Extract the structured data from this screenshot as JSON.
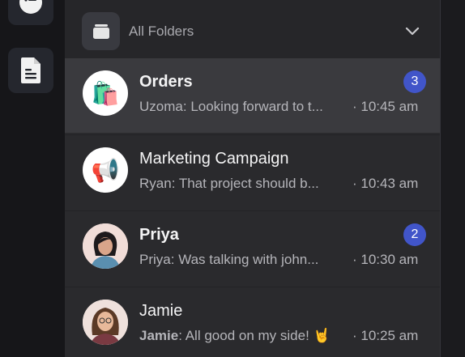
{
  "folders": {
    "label": "All Folders"
  },
  "conversations": [
    {
      "name": "Orders",
      "sender": "Uzoma",
      "message": "Looking forward to t...",
      "time": "· 10:45 am",
      "unread": "3",
      "avatar_emoji": "🛍️"
    },
    {
      "name": "Marketing Campaign",
      "sender": "Ryan",
      "message": "That project should b...",
      "time": "· 10:43 am",
      "avatar_emoji": "📢"
    },
    {
      "name": "Priya",
      "sender": "Priya",
      "message": "Was talking with john...",
      "time": "· 10:30 am",
      "unread": "2"
    },
    {
      "name": "Jamie",
      "sender": "Jamie",
      "message": "All good on my side! 🤘",
      "time": "· 10:25 am"
    }
  ],
  "colors": {
    "accent": "#4155c9",
    "panel": "#2a2a2d",
    "active_row": "#3a3a3e",
    "rail": "#161619"
  }
}
